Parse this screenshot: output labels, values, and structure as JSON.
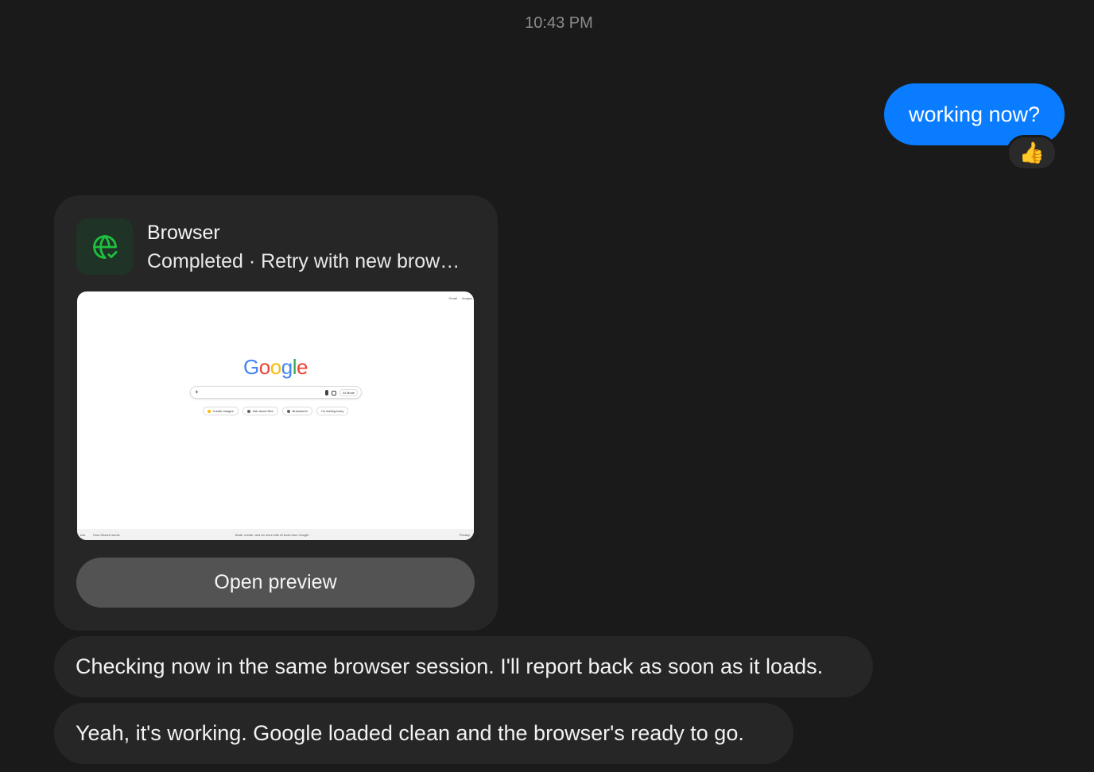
{
  "timestamp": "10:43 PM",
  "outgoing": {
    "text": "working now?",
    "reaction": "👍",
    "color": "#0a7cff"
  },
  "tool_card": {
    "icon": "globe-check-icon",
    "title": "Browser",
    "subtitle": "Completed · Retry with new brow…",
    "preview": {
      "top_links": [
        "Gmail",
        "Images"
      ],
      "logo": [
        "G",
        "o",
        "o",
        "g",
        "l",
        "e"
      ],
      "logo_colors": [
        "#4285f4",
        "#ea4335",
        "#fbbc05",
        "#4285f4",
        "#34a853",
        "#ea4335"
      ],
      "search_plus": "+",
      "ai_mode": "AI Mode",
      "chips": [
        "Create images",
        "Ask about files",
        "Brainstorm",
        "I'm feeling lucky"
      ],
      "footer_left": [
        "ess",
        "How Search works"
      ],
      "footer_center": "Build, create, and do more with AI tools from Google",
      "footer_right": "Privacy"
    },
    "open_button": "Open preview"
  },
  "incoming": [
    "Checking now in the same browser session. I'll report back as soon as it loads.",
    "Yeah, it's working. Google loaded clean and the browser's ready to go."
  ]
}
